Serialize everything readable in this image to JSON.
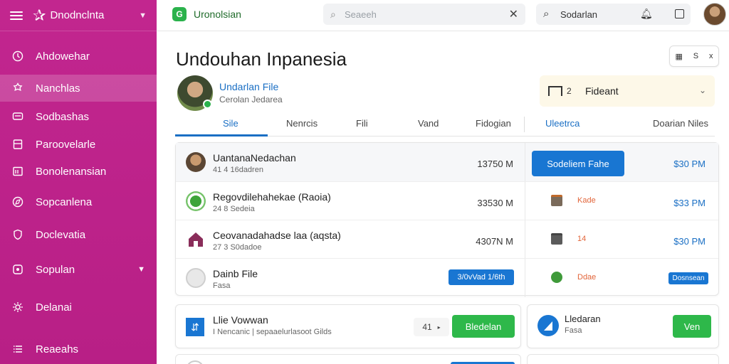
{
  "sidebar": {
    "brand": "Dnodnclnta",
    "items": [
      {
        "label": "Ahdowehar",
        "icon": "clock-icon"
      },
      {
        "label": "Nanchlas",
        "icon": "gear-icon"
      },
      {
        "label": "Sodbashas",
        "icon": "chat-icon"
      },
      {
        "label": "Paroovelarle",
        "icon": "bookmark-icon"
      },
      {
        "label": "Bonolenansian",
        "icon": "calendar-icon"
      },
      {
        "label": "Sopcanlena",
        "icon": "compass-icon"
      },
      {
        "label": "Doclevatia",
        "icon": "shield-icon"
      },
      {
        "label": "Sopulan",
        "icon": "settings-icon"
      },
      {
        "label": "Delanai",
        "icon": "cog-icon"
      },
      {
        "label": "Reaeahs",
        "icon": "list-icon"
      }
    ]
  },
  "topbar": {
    "app_name": "Uronolsian",
    "app_logo_letter": "G",
    "search_placeholder": "Seaeeh",
    "search2_label": "Sodarlan"
  },
  "main": {
    "title": "Undouhan Inpanesia",
    "tool_labels": [
      "S",
      "x"
    ],
    "profile": {
      "name": "Undarlan File",
      "subtitle": "Cerolan Jedarea"
    },
    "dropdown": {
      "number": "2",
      "label": "Fideant"
    },
    "tabs": [
      "Sile",
      "Nenrcis",
      "Fili",
      "Vand",
      "Fidogian",
      "Uleetrca",
      "Doarian Niles"
    ]
  },
  "files": [
    {
      "title": "UantanaNedachan",
      "sub": "41 4 16dadren",
      "size": "13750 M",
      "action": "Sodeliem Fahe",
      "time": "$30 PM"
    },
    {
      "title": "Regovdilehahekae (Raoia)",
      "sub": "24 8 Sedeia",
      "size": "33530 M",
      "tag": "Kade",
      "time": "$33 PM"
    },
    {
      "title": "Ceovanadahadse laa (aqsta)",
      "sub": "27 3 S0dadoe",
      "size": "4307N M",
      "tag": "14",
      "time": "$30 PM"
    },
    {
      "title": "Dainb File",
      "sub": "Fasa",
      "action": "3/0vVad 1/6th",
      "tag": "Ddae",
      "action2": "Dosnsean"
    }
  ],
  "bottom": {
    "card1": {
      "title": "Llie Vowwan",
      "sub": "I Nencanic | sepaaelurlasoot Gilds",
      "counter": "41",
      "button": "Bledelan"
    },
    "card2": {
      "title": "Lledaran",
      "sub": "Fasa",
      "button": "Ven"
    }
  },
  "colors": {
    "sidebar": "#c2268f",
    "accent": "#1976d2",
    "green": "#2eb84a"
  }
}
